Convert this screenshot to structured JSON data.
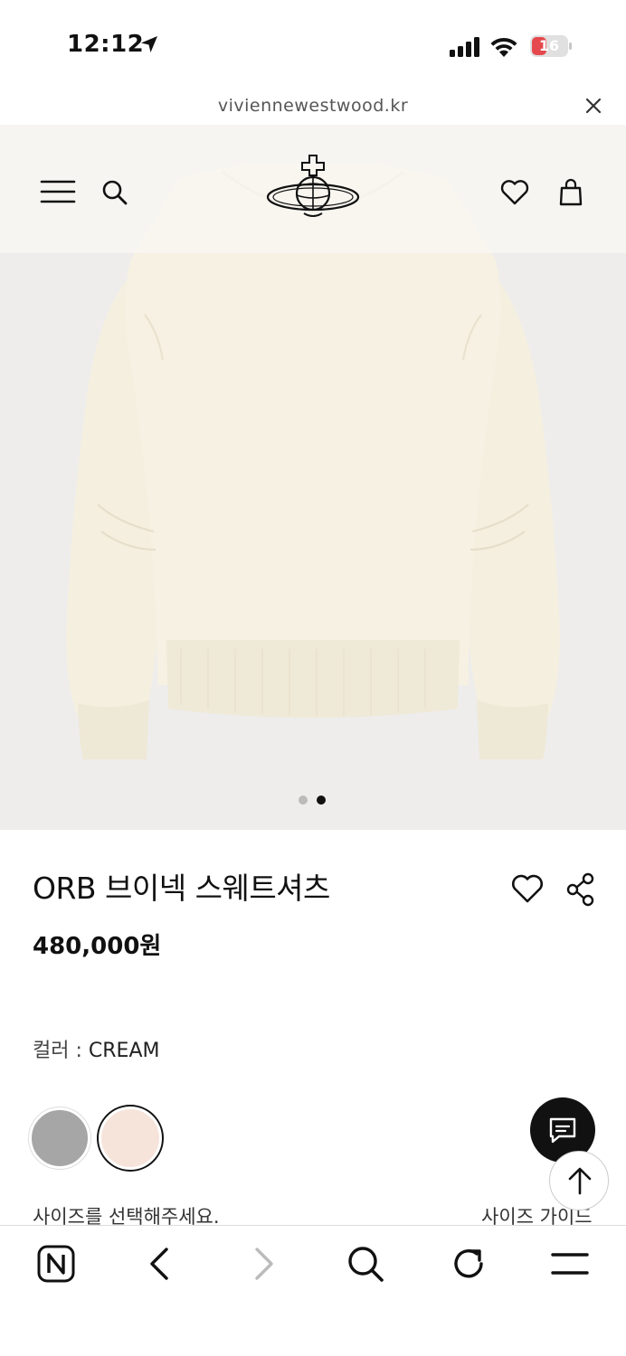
{
  "status_bar": {
    "time": "12:12",
    "battery": "16"
  },
  "browser": {
    "url": "viviennewestwood.kr"
  },
  "product": {
    "name": "ORB 브이넥 스웨트셔츠",
    "price": "480,000원",
    "color_label": "컬러 : ",
    "color_value": "CREAM",
    "size_prompt": "사이즈를 선택해주세요.",
    "size_guide": "사이즈 가이드",
    "swatches": [
      {
        "name": "gray",
        "color": "#a6a6a6",
        "selected": false
      },
      {
        "name": "cream",
        "color": "#f6e4da",
        "selected": true
      }
    ],
    "image_pages": 2,
    "current_page": 2
  },
  "colors": {
    "accent": "#111111",
    "battery_low": "#e5484d",
    "image_bg": "#eeedec",
    "sweatshirt": "#f5f0e1"
  },
  "icons": {
    "header": [
      "hamburger-icon",
      "search-icon",
      "orb-logo",
      "heart-icon",
      "bag-icon"
    ],
    "bottom_nav": [
      "naver-n-icon",
      "back-icon",
      "forward-icon",
      "search-icon",
      "reload-icon",
      "menu-icon"
    ]
  }
}
